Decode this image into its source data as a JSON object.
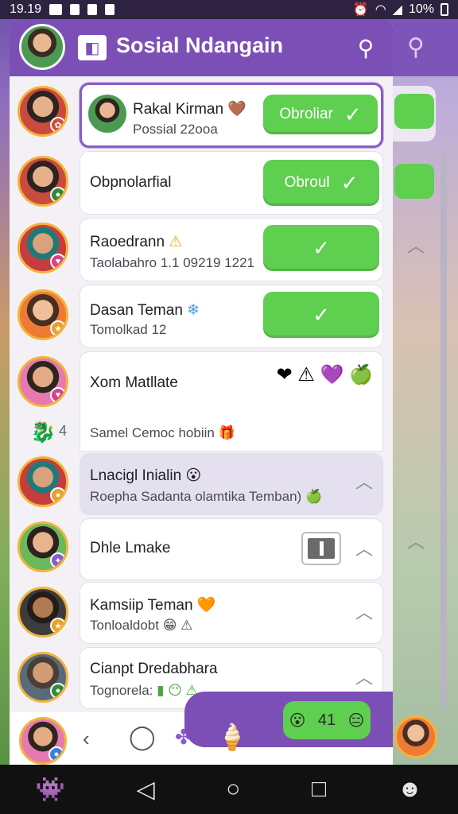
{
  "status_bar": {
    "time": "19.19",
    "battery": "10%"
  },
  "header": {
    "title": "Sosial Ndangain"
  },
  "friends": [
    {
      "name": "Rakal Kirman",
      "emoji": "🤎",
      "sub": "Possial 22ooa",
      "button_label": "Obroliar",
      "avatar_color": "green"
    },
    {
      "name": "Obpnolarfial",
      "button_label": "Obroul",
      "avatar_color": "red"
    },
    {
      "name": "Raoedrann",
      "emoji": "⚠",
      "sub": "Taolabahro 1.1 09219 1221",
      "avatar_color": "teal"
    },
    {
      "name": "Dasan Teman",
      "emoji": "❄",
      "sub": "Tomolkad 12",
      "avatar_color": "orange"
    },
    {
      "name": "Xom Matllate",
      "reactions": "❤ ⚠ 💜 🍏",
      "avatar_color": "pink"
    },
    {
      "name": "Lnacigl Inialin",
      "emoji": "😮",
      "sub": "Roepha Sadanta olamtika Temban)",
      "avatar_color": "teal"
    },
    {
      "name": "Dhle Lmake",
      "avatar_color": "purple"
    },
    {
      "name": "Kamsiip Teman",
      "emoji": "🧡",
      "sub": "Tonloaldobt",
      "avatar_color": "dark"
    },
    {
      "name": "Cianpt Dredabhara",
      "sub": "Tognorela:",
      "avatar_color": "gray"
    }
  ],
  "group_row": {
    "label": "Samel Cemoc hobiin",
    "number": "4"
  },
  "bottom": {
    "count": "41"
  },
  "colors": {
    "accent": "#7c4fb6",
    "green": "#5fcf4f",
    "selected_border": "#8a5cc8"
  }
}
